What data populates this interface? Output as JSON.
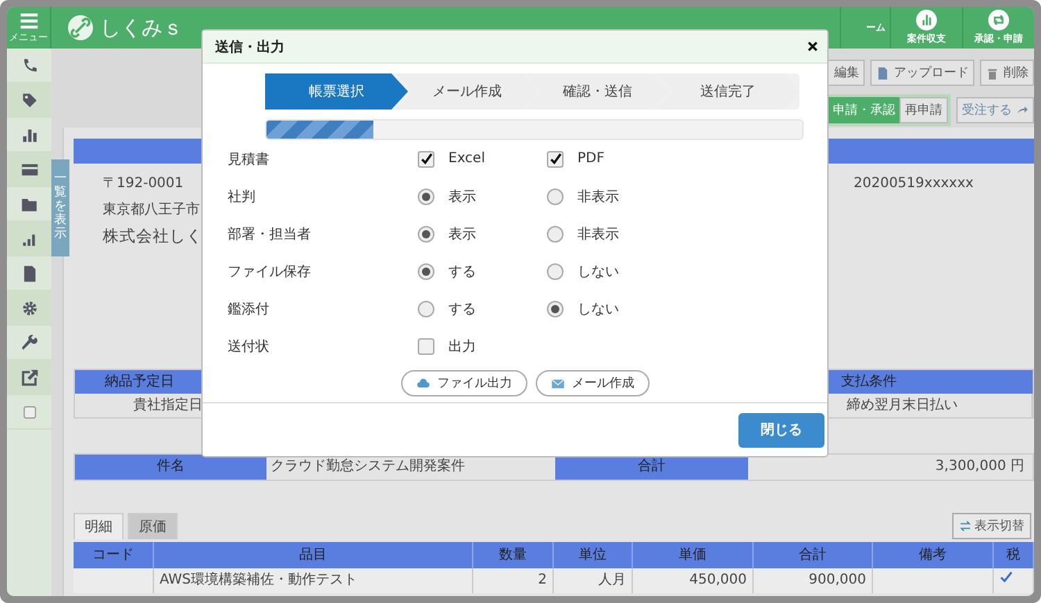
{
  "header": {
    "menu_label": "メニュー",
    "logo_text": "しくみｓ",
    "nav": [
      {
        "label": "ーム"
      },
      {
        "label": "案件収支"
      },
      {
        "label": "承認・申請"
      }
    ]
  },
  "toolbar": {
    "buttons": [
      {
        "label": "編集"
      },
      {
        "label": "アップロード"
      },
      {
        "label": "削除"
      }
    ],
    "status": "申請・承認",
    "reapply": "再申請",
    "order": "受注する"
  },
  "side_tab": "一覧を表示",
  "document": {
    "postal": "〒192-0001",
    "address": "東京都八王子市",
    "company": "株式会社しく",
    "number": "20200519xxxxxx",
    "info": {
      "headers": [
        "納品予定日",
        "支払条件"
      ],
      "values": [
        "貴社指定日",
        "締め翌月末日払い"
      ]
    },
    "subject_label": "件名",
    "subject": "クラウド勤怠システム開発案件",
    "total_label": "合計",
    "total": "3,300,000 円",
    "tabs": [
      {
        "label": "明細",
        "selected": true
      },
      {
        "label": "原価",
        "selected": false
      }
    ],
    "toggle_button": "表示切替",
    "columns": [
      "コード",
      "品目",
      "数量",
      "単位",
      "単価",
      "合計",
      "備考",
      "税"
    ],
    "rows": [
      {
        "code": "",
        "item": "AWS環境構築補佐・動作テスト",
        "qty": "2",
        "unit": "人月",
        "price": "450,000",
        "amount": "900,000",
        "note": "",
        "tax": true
      }
    ]
  },
  "dialog": {
    "title": "送信・出力",
    "steps": [
      {
        "label": "帳票選択",
        "selected": true
      },
      {
        "label": "メール作成",
        "selected": false
      },
      {
        "label": "確認・送信",
        "selected": false
      },
      {
        "label": "送信完了",
        "selected": false
      }
    ],
    "progress": {
      "level": 0.2
    },
    "rows": [
      {
        "label": "見積書",
        "kind": "checkbox",
        "options": [
          {
            "label": "Excel",
            "checked": true
          },
          {
            "label": "PDF",
            "checked": true
          }
        ]
      },
      {
        "label": "社判",
        "kind": "radio",
        "options": [
          {
            "label": "表示",
            "selected": true
          },
          {
            "label": "非表示",
            "selected": false
          }
        ]
      },
      {
        "label": "部署・担当者",
        "kind": "radio",
        "options": [
          {
            "label": "表示",
            "selected": true
          },
          {
            "label": "非表示",
            "selected": false
          }
        ]
      },
      {
        "label": "ファイル保存",
        "kind": "radio",
        "options": [
          {
            "label": "する",
            "selected": true
          },
          {
            "label": "しない",
            "selected": false
          }
        ]
      },
      {
        "label": "鑑添付",
        "kind": "radio",
        "options": [
          {
            "label": "する",
            "selected": false
          },
          {
            "label": "しない",
            "selected": true
          }
        ]
      },
      {
        "label": "送付状",
        "kind": "checkbox",
        "options": [
          {
            "label": "出力",
            "checked": false
          }
        ]
      }
    ],
    "actions": [
      {
        "label": "ファイル出力",
        "kind": "file"
      },
      {
        "label": "メール作成",
        "kind": "mail"
      }
    ],
    "close_button": "閉じる"
  }
}
